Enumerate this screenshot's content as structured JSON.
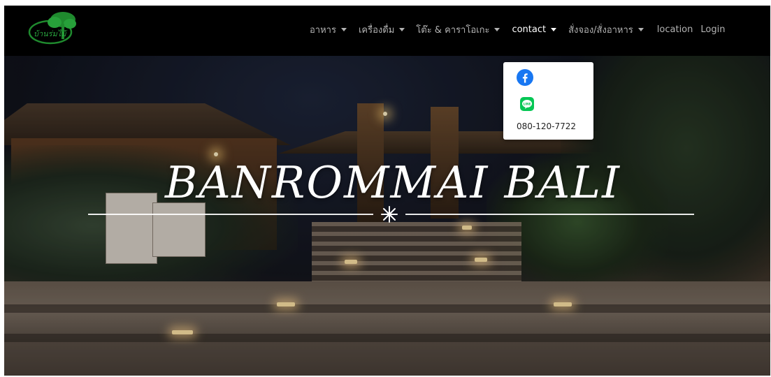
{
  "navbar": {
    "logo_text": "บ้านร่มไม้",
    "items": [
      {
        "label": "อาหาร",
        "has_caret": true
      },
      {
        "label": "เครื่องดื่ม",
        "has_caret": true
      },
      {
        "label": "โต๊ะ & คาราโอเกะ",
        "has_caret": true
      },
      {
        "label": "contact",
        "has_caret": true,
        "active": true
      },
      {
        "label": "สั่งจอง/สั่งอาหาร",
        "has_caret": true
      },
      {
        "label": "location",
        "has_caret": false
      },
      {
        "label": "Login",
        "has_caret": false
      }
    ]
  },
  "contact_dropdown": {
    "facebook_icon": "facebook-icon",
    "line_icon": "line-icon",
    "line_badge_text": "LINE",
    "phone": "080-120-7722"
  },
  "hero": {
    "title": "BANROMMAI BALI"
  },
  "colors": {
    "navbar_bg": "#000000",
    "nav_text": "#b3b3b3",
    "nav_active": "#ffffff",
    "facebook_blue": "#1877f2",
    "line_green": "#06c755",
    "logo_green": "#1f8a2e"
  }
}
